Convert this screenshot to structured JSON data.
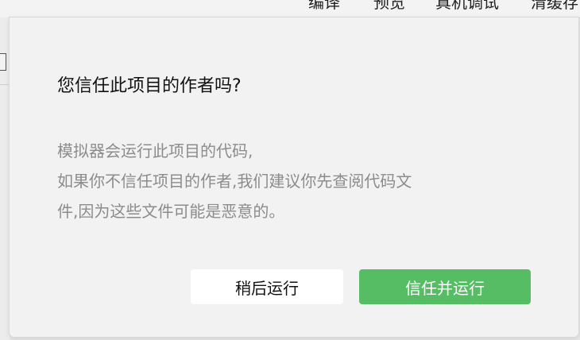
{
  "toolbar": {
    "compile_label": "编译",
    "preview_label": "预览",
    "device_debug_label": "真机调试",
    "clear_cache_label": "清缓存"
  },
  "dialog": {
    "title": "您信任此项目的作者吗?",
    "message_lines": [
      "模拟器会运行此项目的代码,",
      "如果你不信任项目的作者,我们建议你先查阅代码文",
      "件,因为这些文件可能是恶意的。"
    ],
    "buttons": {
      "later_label": "稍后运行",
      "trust_label": "信任并运行"
    }
  },
  "colors": {
    "dialog_background": "#f2f2f2",
    "title_text": "#111111",
    "message_text": "#8c8c8c",
    "primary_button": "#56bd65",
    "secondary_button": "#ffffff"
  }
}
